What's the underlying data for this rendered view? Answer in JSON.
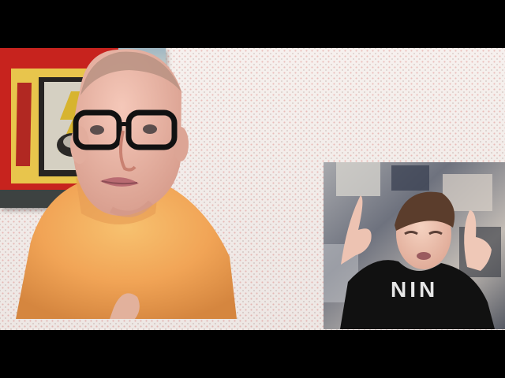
{
  "poster_text": "",
  "inset_shirt_text": "NIN",
  "colors": {
    "wall": "#f5efec",
    "wall_dot": "#e9b7b3",
    "frame_red": "#c7231e",
    "print_yellow": "#e8c54c",
    "shirt_orange": "#f1a456",
    "inset_shirt_black": "#111111"
  }
}
